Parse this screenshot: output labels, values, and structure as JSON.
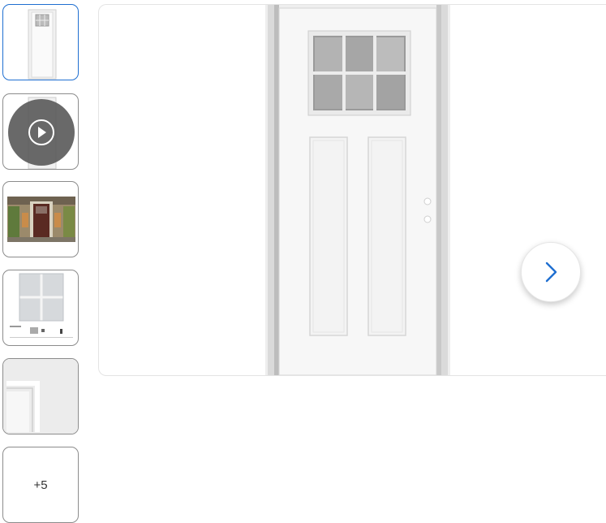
{
  "gallery": {
    "thumbnails": [
      {
        "kind": "image",
        "icon": "door-front-thumbnail",
        "selected": true
      },
      {
        "kind": "video",
        "icon": "play-icon"
      },
      {
        "kind": "image",
        "icon": "door-installed-thumbnail"
      },
      {
        "kind": "image",
        "icon": "spec-sheet-thumbnail"
      },
      {
        "kind": "image",
        "icon": "door-corner-detail-thumbnail"
      }
    ],
    "more_label": "+5"
  },
  "main_image": {
    "icon": "door-product-image"
  },
  "next_button": {
    "icon": "chevron-right-icon"
  },
  "colors": {
    "accent": "#1f6fd1"
  }
}
